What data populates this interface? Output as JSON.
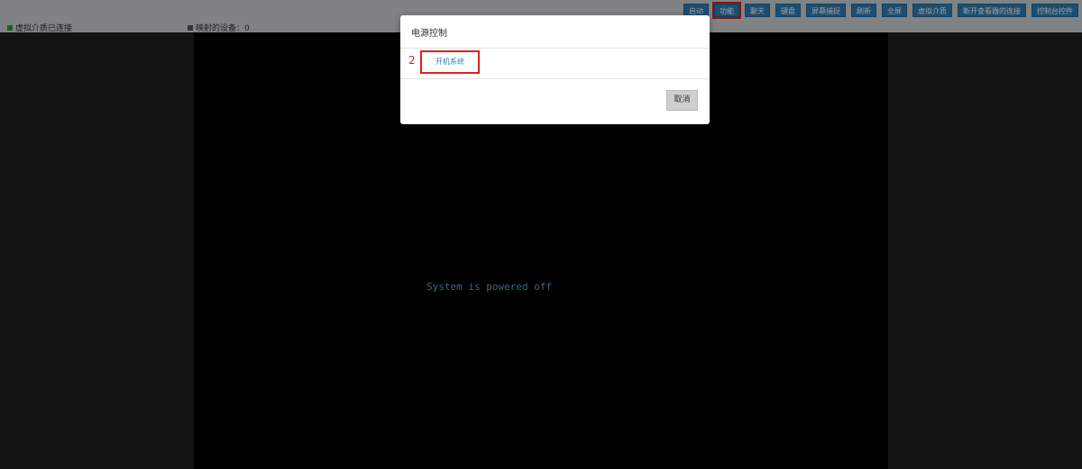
{
  "toolbar": {
    "buttons": [
      {
        "label": "启动"
      },
      {
        "label": "功能"
      },
      {
        "label": "聊天"
      },
      {
        "label": "键盘"
      },
      {
        "label": "屏幕捕捉"
      },
      {
        "label": "刷新"
      },
      {
        "label": "全屏"
      },
      {
        "label": "虚拟介质"
      },
      {
        "label": "断开查看器的连接"
      },
      {
        "label": "控制台控件"
      }
    ],
    "active_index": 1
  },
  "status": {
    "virtual_media": "虚拟介质已连接",
    "mapped_devices": "映射的设备：0"
  },
  "console": {
    "message": "System is powered off"
  },
  "modal": {
    "title": "电源控制",
    "step_label": "2",
    "power_on_label": "开机系统",
    "cancel_label": "取消"
  },
  "colors": {
    "accent": "#2f7fb8",
    "highlight": "#e02020",
    "console_text": "#5aa9c9"
  }
}
